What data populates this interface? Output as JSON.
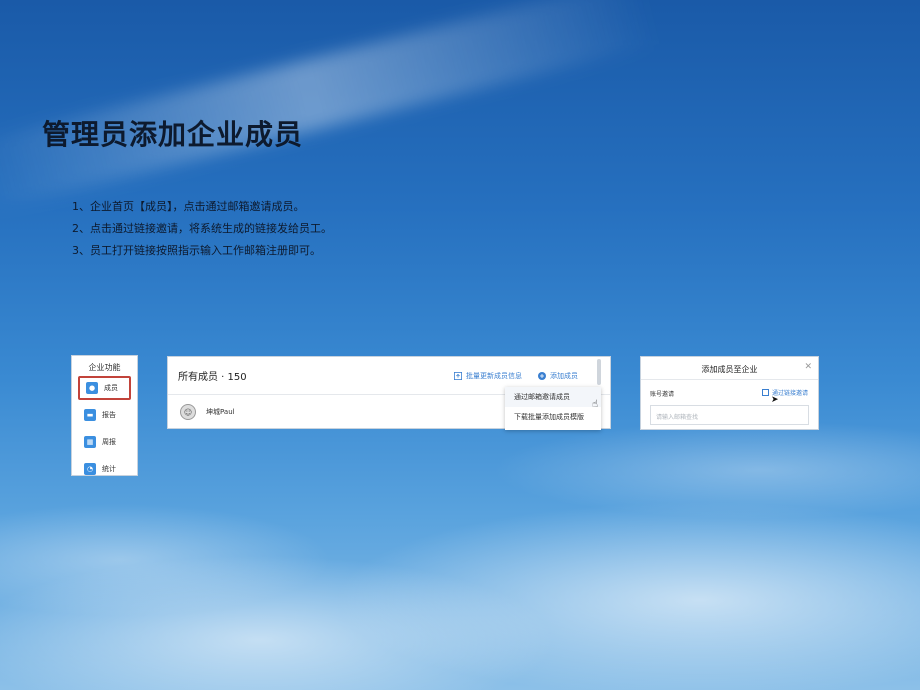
{
  "slide": {
    "title": "管理员添加企业成员",
    "steps": [
      "1、企业首页【成员】，点击通过邮箱邀请成员。",
      "2、点击通过链接邀请，将系统生成的链接发给员工。",
      "3、员工打开链接按照指示输入工作邮箱注册即可。"
    ]
  },
  "features_panel": {
    "title": "企业功能",
    "items": [
      {
        "label": "成员",
        "icon": "user-icon",
        "active": true
      },
      {
        "label": "报告",
        "icon": "report-icon",
        "active": false
      },
      {
        "label": "周报",
        "icon": "calendar-icon",
        "active": false
      },
      {
        "label": "统计",
        "icon": "chart-icon",
        "active": false
      }
    ]
  },
  "members_panel": {
    "title": "所有成员 · 150",
    "batch_update_label": "批量更新成员信息",
    "add_member_label": "添加成员",
    "member": {
      "name": "坤城Paul",
      "avatar_icon": "avatar-icon"
    },
    "dropdown": [
      "通过邮箱邀请成员",
      "下载批量添加成员模版"
    ]
  },
  "add_dialog": {
    "title": "添加成员至企业",
    "account_label": "账号邀请",
    "link_invite_label": "通过链接邀请",
    "input_placeholder": "请输入邮箱查找"
  },
  "colors": {
    "accent": "#3a7fd0",
    "active_border": "#c2433a",
    "icon_bg": "#3b8fe0"
  }
}
